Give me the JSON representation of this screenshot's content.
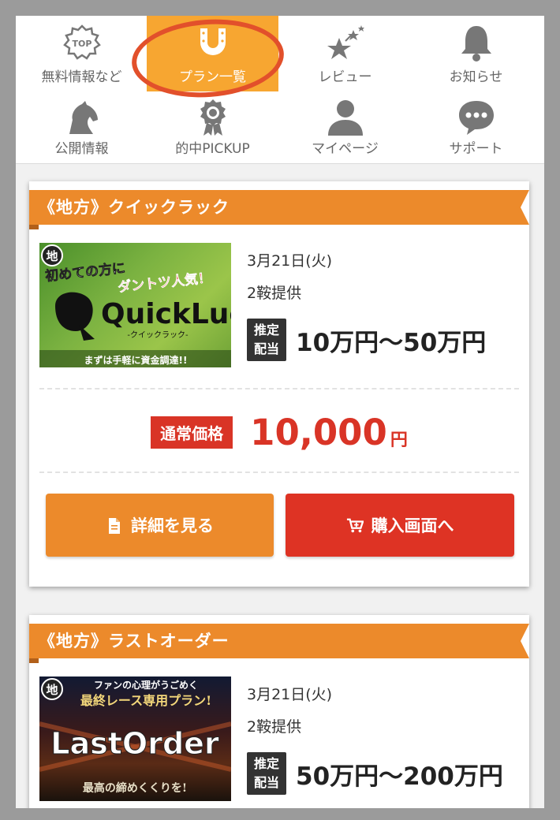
{
  "nav": {
    "items": [
      {
        "label": "無料情報など",
        "icon": "top-badge-icon"
      },
      {
        "label": "プラン一覧",
        "icon": "horseshoe-icon",
        "active": true
      },
      {
        "label": "レビュー",
        "icon": "stars-icon"
      },
      {
        "label": "お知らせ",
        "icon": "bell-icon"
      },
      {
        "label": "公開情報",
        "icon": "horse-icon"
      },
      {
        "label": "的中PICKUP",
        "icon": "medal-icon"
      },
      {
        "label": "マイページ",
        "icon": "user-icon"
      },
      {
        "label": "サポート",
        "icon": "chat-icon"
      }
    ],
    "top_badge_text": "TOP"
  },
  "plans": [
    {
      "title": "《地方》クイックラック",
      "banner": {
        "badge": "地",
        "line1": "初めての方に",
        "line2": "ダントツ人気！",
        "logo": "QuickLuck",
        "sub": "-クイックラック-",
        "bottom": "まずは手軽に資金調達!!"
      },
      "date": "3月21日(火)",
      "races": "2鞍提供",
      "payout_tag_line1": "推定",
      "payout_tag_line2": "配当",
      "payout_range": "10万円〜50万円",
      "price_tag": "通常価格",
      "price_value": "10,000",
      "price_unit": "円",
      "detail_button": "詳細を見る",
      "buy_button": "購入画面へ"
    },
    {
      "title": "《地方》ラストオーダー",
      "banner": {
        "badge": "地",
        "line1": "ファンの心理がうごめく",
        "line2": "最終レース専用プラン!",
        "logo": "LastOrder",
        "bottom": "最高の締めくくりを!"
      },
      "date": "3月21日(火)",
      "races": "2鞍提供",
      "payout_tag_line1": "推定",
      "payout_tag_line2": "配当",
      "payout_range": "50万円〜200万円"
    }
  ],
  "colors": {
    "accent_orange": "#ec8a2b",
    "active_tab": "#f7a631",
    "price_red": "#d93426",
    "highlight_circle": "#e2502b"
  }
}
